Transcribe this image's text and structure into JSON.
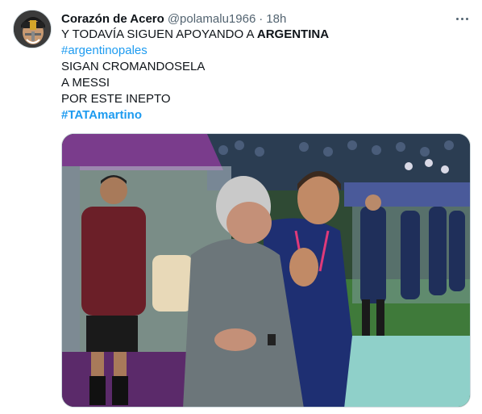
{
  "tweet": {
    "author": {
      "display_name": "Corazón de Acero",
      "handle": "@polamalu1966",
      "avatar_icon": "avatar-icon"
    },
    "separator": "·",
    "timestamp": "18h",
    "more_icon": "more-options-icon",
    "text": {
      "line1_prefix": "Y TODAVÍA SIGUEN APOYANDO A ",
      "line1_bold": "ARGENTINA",
      "hashtag1": "#argentinopales",
      "line3": "SIGAN CROMANDOSELA",
      "line4": "A MESSI",
      "line5": "POR ESTE INEPTO",
      "hashtag2": "#TATAmartino"
    },
    "media": {
      "type": "photo",
      "description_icon": "photo-image"
    }
  },
  "colors": {
    "link": "#1d9bf0",
    "secondary_text": "#536471",
    "primary_text": "#0f1419",
    "border": "#cfd9de"
  }
}
